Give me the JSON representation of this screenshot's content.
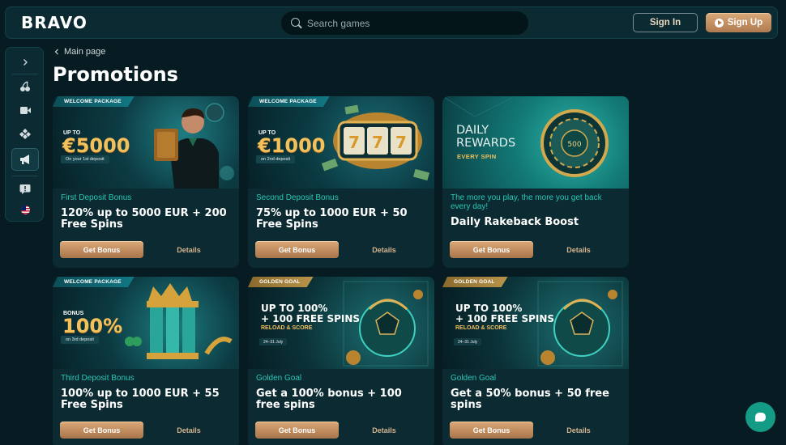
{
  "header": {
    "logo": "BRAVO",
    "search_placeholder": "Search games",
    "signin_label": "Sign In",
    "signup_label": "Sign Up"
  },
  "sidebar": {
    "items": [
      {
        "icon": "chevron-right-icon"
      },
      {
        "icon": "cherries-icon"
      },
      {
        "icon": "video-camera-icon"
      },
      {
        "icon": "diamonds-icon"
      },
      {
        "icon": "megaphone-icon",
        "active": true
      },
      {
        "icon": "alert-bubble-icon"
      },
      {
        "icon": "uk-flag-icon"
      }
    ]
  },
  "breadcrumb": {
    "label": "Main page"
  },
  "page": {
    "title": "Promotions"
  },
  "colors": {
    "accent_teal": "#29c7b7",
    "gold": "#f2c15c",
    "button": "#c99566",
    "background": "#061c22"
  },
  "cards": [
    {
      "tag": "WELCOME PACKAGE",
      "banner_upto": "UP TO",
      "banner_amount": "€5000",
      "banner_sub": "On your 1st deposit",
      "category": "First Deposit Bonus",
      "title": "120% up to 5000 EUR + 200 Free Spins",
      "bonus_label": "Get Bonus",
      "details_label": "Details"
    },
    {
      "tag": "WELCOME PACKAGE",
      "banner_upto": "UP TO",
      "banner_amount": "€1000",
      "banner_sub": "on 2nd deposit",
      "category": "Second Deposit Bonus",
      "title": "75% up to 1000 EUR + 50 Free Spins",
      "bonus_label": "Get Bonus",
      "details_label": "Details"
    },
    {
      "banner_line1": "DAILY",
      "banner_line2": "REWARDS",
      "banner_line3": "EVERY SPIN",
      "banner_chip": "500",
      "category": "The more you play, the more you get back every day!",
      "title": "Daily Rakeback Boost",
      "bonus_label": "Get Bonus",
      "details_label": "Details"
    },
    {
      "tag": "WELCOME PACKAGE",
      "banner_upto": "BONUS",
      "banner_amount": "100%",
      "banner_sub": "on 3rd deposit",
      "category": "Third Deposit Bonus",
      "title": "100% up to 1000 EUR + 55 Free Spins",
      "bonus_label": "Get Bonus",
      "details_label": "Details"
    },
    {
      "tag": "GOLDEN GOAL",
      "banner_line1": "UP TO 100%",
      "banner_line2": "+ 100 FREE SPINS",
      "banner_line3": "RELOAD & SCORE",
      "banner_date": "24–31 July",
      "category": "Golden Goal",
      "title": "Get a 100% bonus + 100 free spins",
      "bonus_label": "Get Bonus",
      "details_label": "Details"
    },
    {
      "tag": "GOLDEN GOAL",
      "banner_line1": "UP TO 100%",
      "banner_line2": "+ 100 FREE SPINS",
      "banner_line3": "RELOAD & SCORE",
      "banner_date": "24–31 July",
      "category": "Golden Goal",
      "title": "Get a 50% bonus + 50 free spins",
      "bonus_label": "Get Bonus",
      "details_label": "Details"
    }
  ]
}
